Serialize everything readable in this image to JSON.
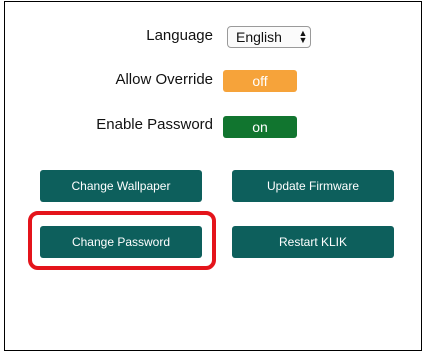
{
  "settings": {
    "language": {
      "label": "Language",
      "value": "English"
    },
    "allow_override": {
      "label": "Allow Override",
      "state": "off"
    },
    "enable_password": {
      "label": "Enable Password",
      "state": "on"
    }
  },
  "actions": {
    "change_wallpaper": "Change Wallpaper",
    "update_firmware": "Update Firmware",
    "change_password": "Change Password",
    "restart_klik": "Restart KLIK"
  },
  "colors": {
    "button_bg": "#0d5f5c",
    "toggle_off": "#f6a33a",
    "toggle_on": "#11752f",
    "highlight": "#e4141b"
  }
}
